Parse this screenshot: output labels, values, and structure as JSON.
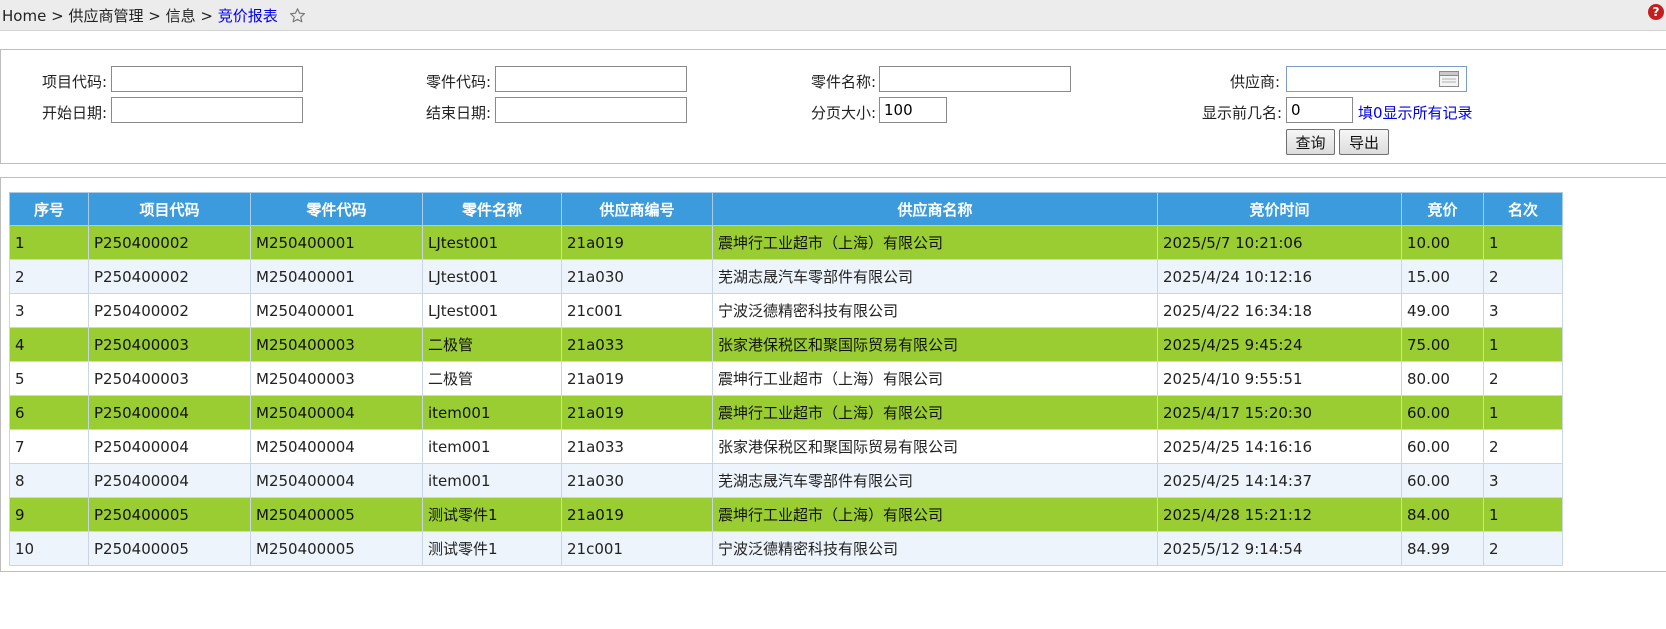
{
  "breadcrumb": {
    "items": [
      "Home",
      "供应商管理",
      "信息"
    ],
    "current": "竞价报表",
    "separator": ">"
  },
  "query": {
    "project_code": {
      "label": "项目代码:",
      "value": ""
    },
    "part_code": {
      "label": "零件代码:",
      "value": ""
    },
    "part_name": {
      "label": "零件名称:",
      "value": ""
    },
    "supplier": {
      "label": "供应商:",
      "value": ""
    },
    "start_date": {
      "label": "开始日期:",
      "value": ""
    },
    "end_date": {
      "label": "结束日期:",
      "value": ""
    },
    "page_size": {
      "label": "分页大小:",
      "value": "100"
    },
    "top_n": {
      "label": "显示前几名:",
      "value": "0"
    },
    "top_n_hint": "填0显示所有记录",
    "search_label": "查询",
    "export_label": "导出"
  },
  "table": {
    "headers": [
      "序号",
      "项目代码",
      "零件代码",
      "零件名称",
      "供应商编号",
      "供应商名称",
      "竞价时间",
      "竞价",
      "名次"
    ],
    "rows": [
      [
        "1",
        "P250400002",
        "M250400001",
        "LJtest001",
        "21a019",
        "震坤行工业超市（上海）有限公司",
        "2025/5/7 10:21:06",
        "10.00",
        "1"
      ],
      [
        "2",
        "P250400002",
        "M250400001",
        "LJtest001",
        "21a030",
        "芜湖志晟汽车零部件有限公司",
        "2025/4/24 10:12:16",
        "15.00",
        "2"
      ],
      [
        "3",
        "P250400002",
        "M250400001",
        "LJtest001",
        "21c001",
        "宁波泛德精密科技有限公司",
        "2025/4/22 16:34:18",
        "49.00",
        "3"
      ],
      [
        "4",
        "P250400003",
        "M250400003",
        "二极管",
        "21a033",
        "张家港保税区和聚国际贸易有限公司",
        "2025/4/25 9:45:24",
        "75.00",
        "1"
      ],
      [
        "5",
        "P250400003",
        "M250400003",
        "二极管",
        "21a019",
        "震坤行工业超市（上海）有限公司",
        "2025/4/10 9:55:51",
        "80.00",
        "2"
      ],
      [
        "6",
        "P250400004",
        "M250400004",
        "item001",
        "21a019",
        "震坤行工业超市（上海）有限公司",
        "2025/4/17 15:20:30",
        "60.00",
        "1"
      ],
      [
        "7",
        "P250400004",
        "M250400004",
        "item001",
        "21a033",
        "张家港保税区和聚国际贸易有限公司",
        "2025/4/25 14:16:16",
        "60.00",
        "2"
      ],
      [
        "8",
        "P250400004",
        "M250400004",
        "item001",
        "21a030",
        "芜湖志晟汽车零部件有限公司",
        "2025/4/25 14:14:37",
        "60.00",
        "3"
      ],
      [
        "9",
        "P250400005",
        "M250400005",
        "测试零件1",
        "21a019",
        "震坤行工业超市（上海）有限公司",
        "2025/4/28 15:21:12",
        "84.00",
        "1"
      ],
      [
        "10",
        "P250400005",
        "M250400005",
        "测试零件1",
        "21c001",
        "宁波泛德精密科技有限公司",
        "2025/5/12 9:14:54",
        "84.99",
        "2"
      ]
    ],
    "row_styles": [
      "g",
      "l",
      "w",
      "g",
      "w",
      "g",
      "w",
      "l",
      "g",
      "l"
    ],
    "colors": {
      "header": "#3b9bdc",
      "highlight": "#9acd32",
      "alt": "#eef4fb"
    }
  }
}
